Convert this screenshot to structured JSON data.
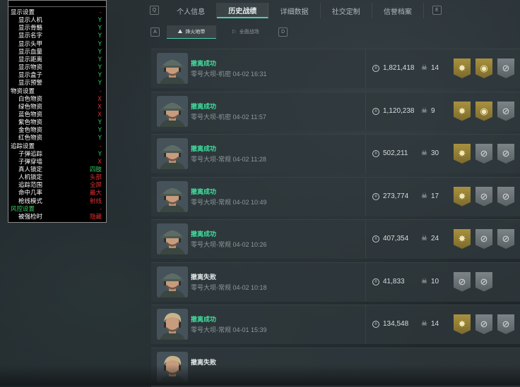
{
  "tabs": {
    "left_key": "Q",
    "right_key": "E",
    "items": [
      {
        "label": "个人信息",
        "active": false
      },
      {
        "label": "历史战绩",
        "active": true
      },
      {
        "label": "详细数据",
        "active": false
      },
      {
        "label": "社交定制",
        "active": false
      },
      {
        "label": "信誉档案",
        "active": false
      }
    ]
  },
  "sub_tabs": {
    "left_key": "A",
    "right_key": "D",
    "items": [
      {
        "label": "烽火地带",
        "active": true,
        "icon": "beacon-icon"
      },
      {
        "label": "全面战场",
        "active": false,
        "icon": "battlefield-icon"
      }
    ]
  },
  "records": [
    {
      "status": "撤离成功",
      "success": true,
      "map": "零号大坝-机密",
      "time": "04-02 16:31",
      "value": "1,821,418",
      "kills": "14",
      "badges": [
        "gold",
        "gold-ring",
        "grey"
      ],
      "hair": "cap"
    },
    {
      "status": "撤离成功",
      "success": true,
      "map": "零号大坝-机密",
      "time": "04-02 11:57",
      "value": "1,120,238",
      "kills": "9",
      "badges": [
        "gold",
        "gold-ring",
        "grey"
      ],
      "hair": "cap"
    },
    {
      "status": "撤离成功",
      "success": true,
      "map": "零号大坝-常规",
      "time": "04-02 11:28",
      "value": "502,211",
      "kills": "30",
      "badges": [
        "gold",
        "grey",
        "grey"
      ],
      "hair": "cap"
    },
    {
      "status": "撤离成功",
      "success": true,
      "map": "零号大坝-常规",
      "time": "04-02 10:49",
      "value": "273,774",
      "kills": "17",
      "badges": [
        "gold",
        "grey",
        "grey"
      ],
      "hair": "cap"
    },
    {
      "status": "撤离成功",
      "success": true,
      "map": "零号大坝-常规",
      "time": "04-02 10:26",
      "value": "407,354",
      "kills": "24",
      "badges": [
        "gold",
        "grey",
        "grey"
      ],
      "hair": "cap"
    },
    {
      "status": "撤离失败",
      "success": false,
      "map": "零号大坝-常规",
      "time": "04-02 10:18",
      "value": "41,833",
      "kills": "10",
      "badges": [
        "grey",
        "grey"
      ],
      "hair": "cap"
    },
    {
      "status": "撤离成功",
      "success": true,
      "map": "零号大坝-常规",
      "time": "04-01 15:39",
      "value": "134,548",
      "kills": "14",
      "badges": [
        "gold",
        "grey",
        "grey"
      ],
      "hair": "blond"
    },
    {
      "status": "撤离失败",
      "success": false,
      "map": "",
      "time": "",
      "value": "",
      "kills": "",
      "badges": [],
      "hair": "blond"
    }
  ],
  "overlay": {
    "items": [
      {
        "label": "显示设置",
        "value": "-",
        "indent": false,
        "color": "#ffffff",
        "vcolor": "#e03030"
      },
      {
        "label": "显示人机",
        "value": "Y",
        "indent": true,
        "color": "#ffffff",
        "vcolor": "#2fd05a"
      },
      {
        "label": "显示骨骼",
        "value": "Y",
        "indent": true,
        "color": "#ffffff",
        "vcolor": "#2fd05a"
      },
      {
        "label": "显示名字",
        "value": "Y",
        "indent": true,
        "color": "#ffffff",
        "vcolor": "#2fd05a"
      },
      {
        "label": "显示头甲",
        "value": "Y",
        "indent": true,
        "color": "#ffffff",
        "vcolor": "#2fd05a"
      },
      {
        "label": "显示血量",
        "value": "Y",
        "indent": true,
        "color": "#ffffff",
        "vcolor": "#2fd05a"
      },
      {
        "label": "显示距离",
        "value": "Y",
        "indent": true,
        "color": "#ffffff",
        "vcolor": "#2fd05a"
      },
      {
        "label": "显示物资",
        "value": "Y",
        "indent": true,
        "color": "#ffffff",
        "vcolor": "#2fd05a"
      },
      {
        "label": "显示盒子",
        "value": "Y",
        "indent": true,
        "color": "#ffffff",
        "vcolor": "#2fd05a"
      },
      {
        "label": "显示预警",
        "value": "Y",
        "indent": true,
        "color": "#ffffff",
        "vcolor": "#2fd05a"
      },
      {
        "label": "物资设置",
        "value": "-",
        "indent": false,
        "color": "#ffffff",
        "vcolor": "#e03030"
      },
      {
        "label": "白色物资",
        "value": "X",
        "indent": true,
        "color": "#ffffff",
        "vcolor": "#e03030"
      },
      {
        "label": "绿色物资",
        "value": "X",
        "indent": true,
        "color": "#ffffff",
        "vcolor": "#e03030"
      },
      {
        "label": "蓝色物资",
        "value": "X",
        "indent": true,
        "color": "#ffffff",
        "vcolor": "#e03030"
      },
      {
        "label": "紫色物资",
        "value": "Y",
        "indent": true,
        "color": "#ffffff",
        "vcolor": "#2fd05a"
      },
      {
        "label": "金色物资",
        "value": "Y",
        "indent": true,
        "color": "#ffffff",
        "vcolor": "#2fd05a"
      },
      {
        "label": "红色物资",
        "value": "Y",
        "indent": true,
        "color": "#ffffff",
        "vcolor": "#2fd05a"
      },
      {
        "label": "追踪设置",
        "value": "-",
        "indent": false,
        "color": "#ffffff",
        "vcolor": "#e03030"
      },
      {
        "label": "子弹追踪",
        "value": "Y",
        "indent": true,
        "color": "#ffffff",
        "vcolor": "#2fd05a"
      },
      {
        "label": "子弹穿墙",
        "value": "X",
        "indent": true,
        "color": "#ffffff",
        "vcolor": "#e03030"
      },
      {
        "label": "真人锁定",
        "value": "四肢",
        "indent": true,
        "color": "#ffffff",
        "vcolor": "#2fd05a"
      },
      {
        "label": "人机锁定",
        "value": "头部",
        "indent": true,
        "color": "#ffffff",
        "vcolor": "#e03030"
      },
      {
        "label": "追踪范围",
        "value": "全屏",
        "indent": true,
        "color": "#ffffff",
        "vcolor": "#e03030"
      },
      {
        "label": "命中几率",
        "value": "最大",
        "indent": true,
        "color": "#ffffff",
        "vcolor": "#e03030"
      },
      {
        "label": "枪线模式",
        "value": "射线",
        "indent": true,
        "color": "#ffffff",
        "vcolor": "#e03030"
      },
      {
        "label": "风控设置",
        "value": "-",
        "indent": false,
        "color": "#3fd060",
        "vcolor": "#e03030"
      },
      {
        "label": "被强检时",
        "value": "隐藏",
        "indent": true,
        "color": "#ffffff",
        "vcolor": "#e03030"
      }
    ]
  }
}
